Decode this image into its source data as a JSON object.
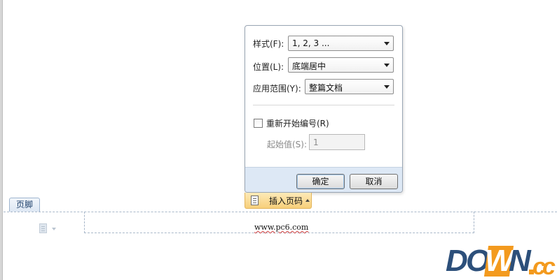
{
  "dialog": {
    "style_label": "样式(F):",
    "style_value": "1, 2, 3 ...",
    "position_label": "位置(L):",
    "position_value": "底端居中",
    "scope_label": "应用范围(Y):",
    "scope_value": "整篇文档",
    "restart_label": "重新开始编号(R)",
    "restart_checked": false,
    "start_label": "起始值(S):",
    "start_value": "1",
    "ok_label": "确定",
    "cancel_label": "取消"
  },
  "insert_tab": {
    "label": "插入页码",
    "icon": "document-icon"
  },
  "footer_tab": {
    "label": "页脚"
  },
  "footer": {
    "text": "www.pc6.com"
  },
  "watermark": {
    "letters": [
      "D",
      "O",
      "W",
      "N",
      "c",
      "c"
    ]
  },
  "colors": {
    "accent_orange": "#f39a1e",
    "brand_navy": "#2c4f7a",
    "footer_bar": "#dde8f5"
  }
}
